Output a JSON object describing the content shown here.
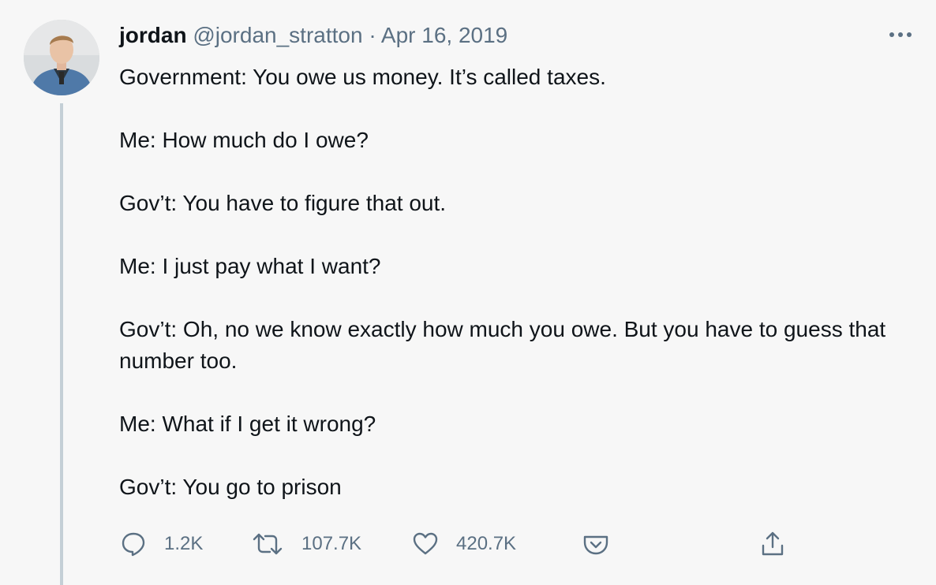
{
  "tweet": {
    "display_name": "jordan",
    "handle": "@jordan_stratton",
    "separator": "·",
    "date": "Apr 16, 2019",
    "paragraphs": [
      "Government: You owe us money. It’s called taxes.",
      "Me: How much do I owe?",
      "Gov’t: You have to figure that out.",
      "Me: I just pay what I want?",
      "Gov’t: Oh, no we know exactly how much you owe. But you have to guess that number too.",
      "Me: What if I get it wrong?",
      "Gov’t: You go to prison"
    ],
    "actions": {
      "reply_count": "1.2K",
      "retweet_count": "107.7K",
      "like_count": "420.7K"
    }
  },
  "icons": {
    "reply": "speech-bubble-icon",
    "retweet": "retweet-arrows-icon",
    "like": "heart-icon",
    "bookmark": "pocket-save-icon",
    "share": "share-upload-icon",
    "more": "three-dots-icon"
  },
  "colors": {
    "background": "#f7f7f7",
    "text": "#0f1419",
    "secondary": "#5b7083",
    "thread_line": "#c4cfd6"
  }
}
